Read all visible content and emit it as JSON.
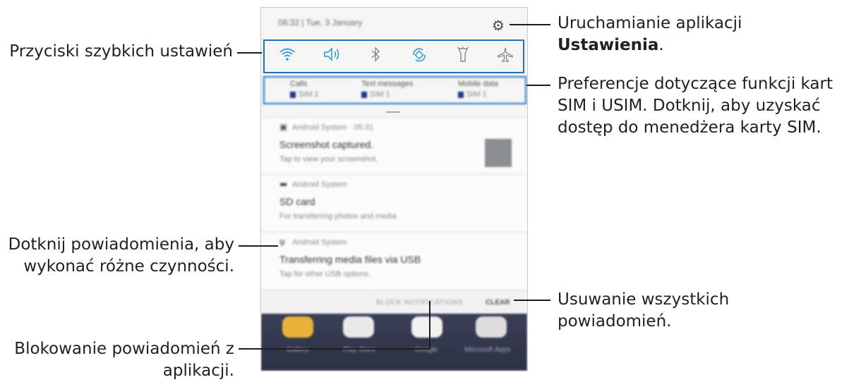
{
  "phone": {
    "status": {
      "time_date": "08:32 | Tue, 3 January",
      "settings_icon": "gear-icon"
    },
    "quick_settings": [
      {
        "name": "wifi-icon",
        "glyph": "ᯤ"
      },
      {
        "name": "sound-icon",
        "glyph": "🔈"
      },
      {
        "name": "bluetooth-icon",
        "glyph": "ᛒ"
      },
      {
        "name": "auto-rotate-icon",
        "glyph": "⟲"
      },
      {
        "name": "flashlight-icon",
        "glyph": "⚲"
      },
      {
        "name": "airplane-mode-icon",
        "glyph": "✈"
      }
    ],
    "sim_prefs": [
      {
        "label": "Calls",
        "sim": "SIM 1"
      },
      {
        "label": "Text messages",
        "sim": "SIM 1"
      },
      {
        "label": "Mobile data",
        "sim": "SIM 1"
      }
    ],
    "notifications": [
      {
        "app": "Android System · 05:31",
        "title": "Screenshot captured.",
        "text": "Tap to view your screenshot."
      },
      {
        "app": "Android System",
        "title": "SD card",
        "text": "For transferring photos and media"
      },
      {
        "app": "Android System",
        "title": "Transferring media files via USB",
        "text": "Tap for other USB options."
      }
    ],
    "actions": {
      "block": "BLOCK NOTIFICATIONS",
      "clear": "CLEAR"
    },
    "home_apps": [
      "Gallery",
      "Play Store",
      "Google",
      "Microsoft Apps"
    ]
  },
  "callouts": {
    "settings": "Uruchamianie aplikacji ",
    "settings_bold": "Ustawienia",
    "settings_end": ".",
    "quick": "Przyciski szybkich ustawień",
    "sim_line1": "Preferencje dotyczące funkcji kart",
    "sim_line2": "SIM i USIM. Dotknij, aby uzyskać",
    "sim_line3": "dostęp do menedżera karty SIM.",
    "notif_line1": "Dotknij powiadomienia, aby",
    "notif_line2": "wykonać różne czynności.",
    "clear_line1": "Usuwanie wszystkich",
    "clear_line2": "powiadomień.",
    "block_line1": "Blokowanie powiadomień z",
    "block_line2": "aplikacji."
  },
  "colors": {
    "highlight": "#1e73be",
    "callout_text": "#231f20"
  }
}
